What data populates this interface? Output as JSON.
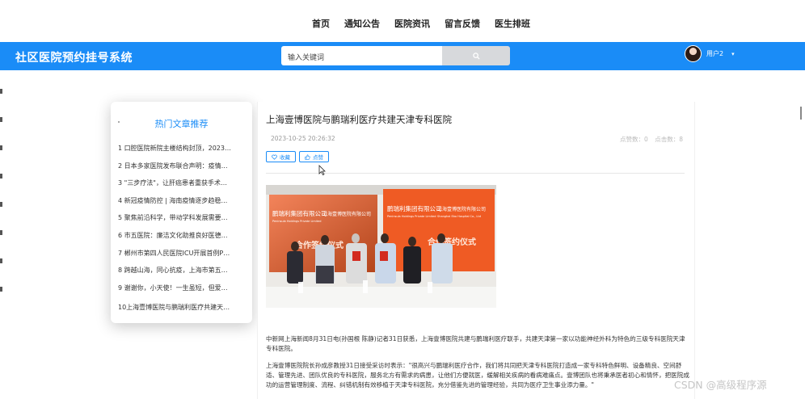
{
  "nav": {
    "items": [
      "首页",
      "通知公告",
      "医院资讯",
      "留言反馈",
      "医生排班"
    ]
  },
  "header": {
    "site_title": "社区医院预约挂号系统",
    "search_placeholder": "输入关键词",
    "username": "用户2"
  },
  "sidebar": {
    "title": "热门文章推荐",
    "items": [
      "1 口腔医院新院主楼结构封顶，2023…",
      "2 日本多家医院发布联合声明：疫情…",
      "3 \"三步疗法\"，让肝癌患者重获手术根…",
      "4 新冠疫情防控 | 海南疫情逐步趋稳…",
      "5 聚焦前沿科学，带动学科发展需要…",
      "6 市五医院：廉洁文化助推良好医德…",
      "7 郴州市第四人民医院ICU开展首例PI…",
      "8 跨越山海，同心抗疫，上海市第五…",
      "9 谢谢你，小天使！一生虽短，但爱…",
      "10上海壹博医院与鹏瑞利医疗共建天…"
    ]
  },
  "article": {
    "title": "上海壹博医院与鹏瑞利医疗共建天津专科医院",
    "date": "2023-10-25 20:26:32",
    "views_label": "点赞数：0",
    "clicks_label": "点击数：8",
    "favorite_label": "收藏",
    "like_label": "点赞",
    "photo": {
      "banner_left_cn": "鹏瑞利集团有限公司",
      "banner_left_en": "Peninsula Holdings Private Limited",
      "banner_right_cn": "上海壹博医院有限公司",
      "banner_right_en": "Shanghai Ebo Hospital Co., Ltd",
      "ceremony_text": "合作签约仪式"
    },
    "paragraph1": "中新网上海新闻8月31日电(孙国根 陈静)记者31日获悉，上海壹博医院共建与鹏瑞利医疗联手，共建天津第一家以功能神经外科为特色的三级专科医院天津专科医院。",
    "paragraph2": "上海壹博医院院长孙成彦教授31日接受采访时表示：\"很高兴与鹏瑞利医疗合作，我们将共同把天津专科医院打造成一家专科特色鲜明、设备精良、空间舒适、管理先进、团队优良的专科医院，服务北方有需求的病患，让他们方便就医，缓解相关疾病的看病难痛点。壹博团队也将秉承医者初心和情怀，把医院成功的运营管理制度、流程、纠错机制有效移植于天津专科医院，充分借鉴先进的管理经验，共同为医疗卫生事业添力量。\""
  },
  "watermark": "CSDN @高级程序源",
  "colors": {
    "primary": "#1a8cf7",
    "search_button": "#d7d9dc"
  }
}
